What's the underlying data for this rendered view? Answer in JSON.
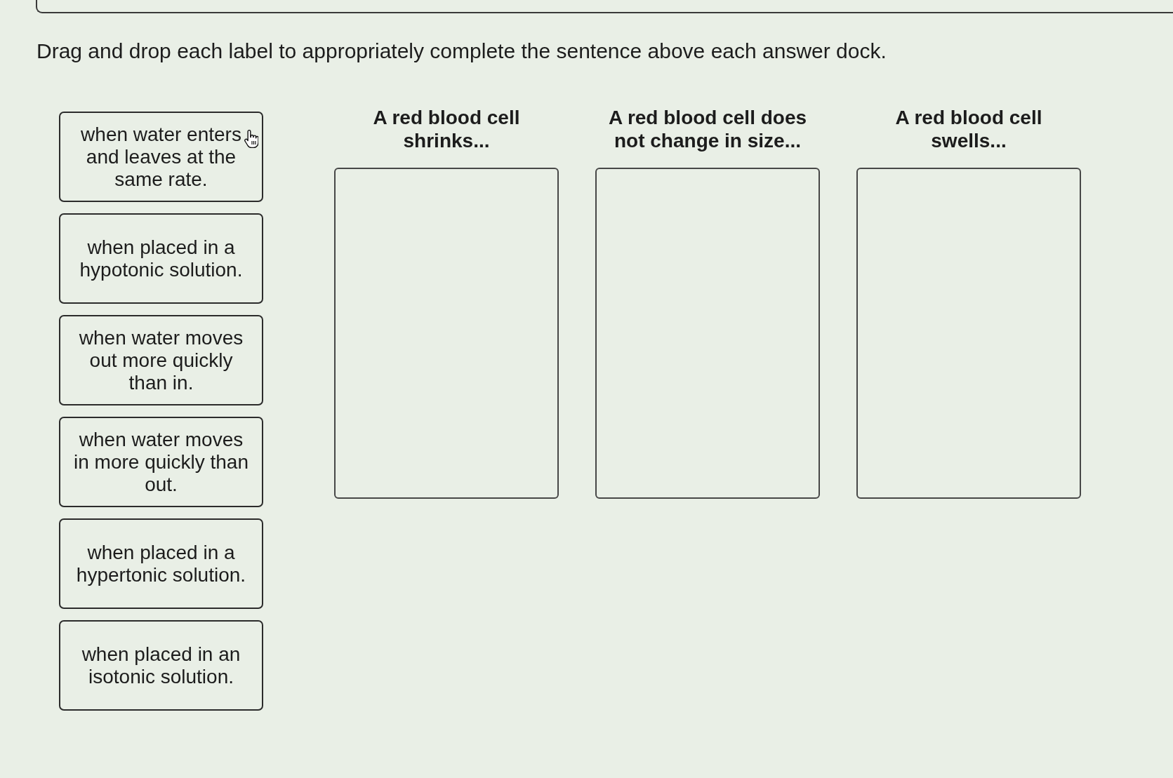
{
  "instruction": "Drag and drop each label to appropriately complete the sentence above each answer dock.",
  "labels": [
    {
      "text": "when water enters and leaves at the same rate.",
      "hovered": true
    },
    {
      "text": "when placed in a hypotonic solution.",
      "hovered": false
    },
    {
      "text": "when water moves out more quickly than in.",
      "hovered": false
    },
    {
      "text": "when water moves in more quickly than out.",
      "hovered": false
    },
    {
      "text": "when placed in a hypertonic solution.",
      "hovered": false
    },
    {
      "text": "when placed in an isotonic solution.",
      "hovered": false
    }
  ],
  "docks": [
    {
      "heading": "A red blood cell shrinks..."
    },
    {
      "heading": "A red blood cell does not change in size..."
    },
    {
      "heading": "A red blood cell swells..."
    }
  ]
}
